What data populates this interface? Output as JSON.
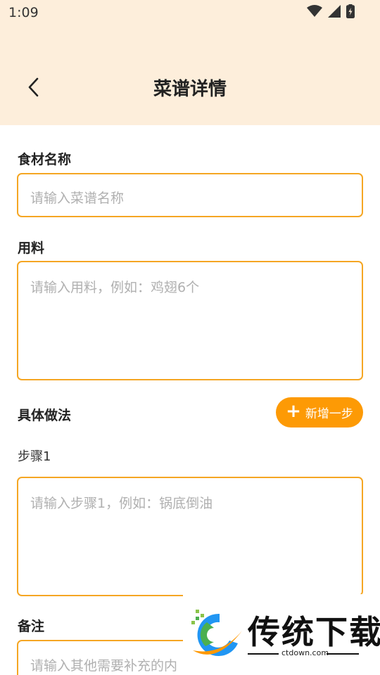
{
  "status_bar": {
    "time": "1:09"
  },
  "header": {
    "title": "菜谱详情"
  },
  "form": {
    "name_label": "食材名称",
    "name_placeholder": "请输入菜谱名称",
    "ingredients_label": "用料",
    "ingredients_placeholder": "请输入用料，例如：鸡翅6个",
    "method_label": "具体做法",
    "add_step_label": "新增一步",
    "step_label": "步骤1",
    "step_placeholder": "请输入步骤1，例如：锅底倒油",
    "notes_label": "备注",
    "notes_placeholder": "请输入其他需要补充的内"
  },
  "watermark": {
    "name": "传统下载",
    "url": "ctdown.com"
  },
  "colors": {
    "header_bg": "#fdeedb",
    "accent": "#fd9a05",
    "field_border": "#f5a623"
  }
}
